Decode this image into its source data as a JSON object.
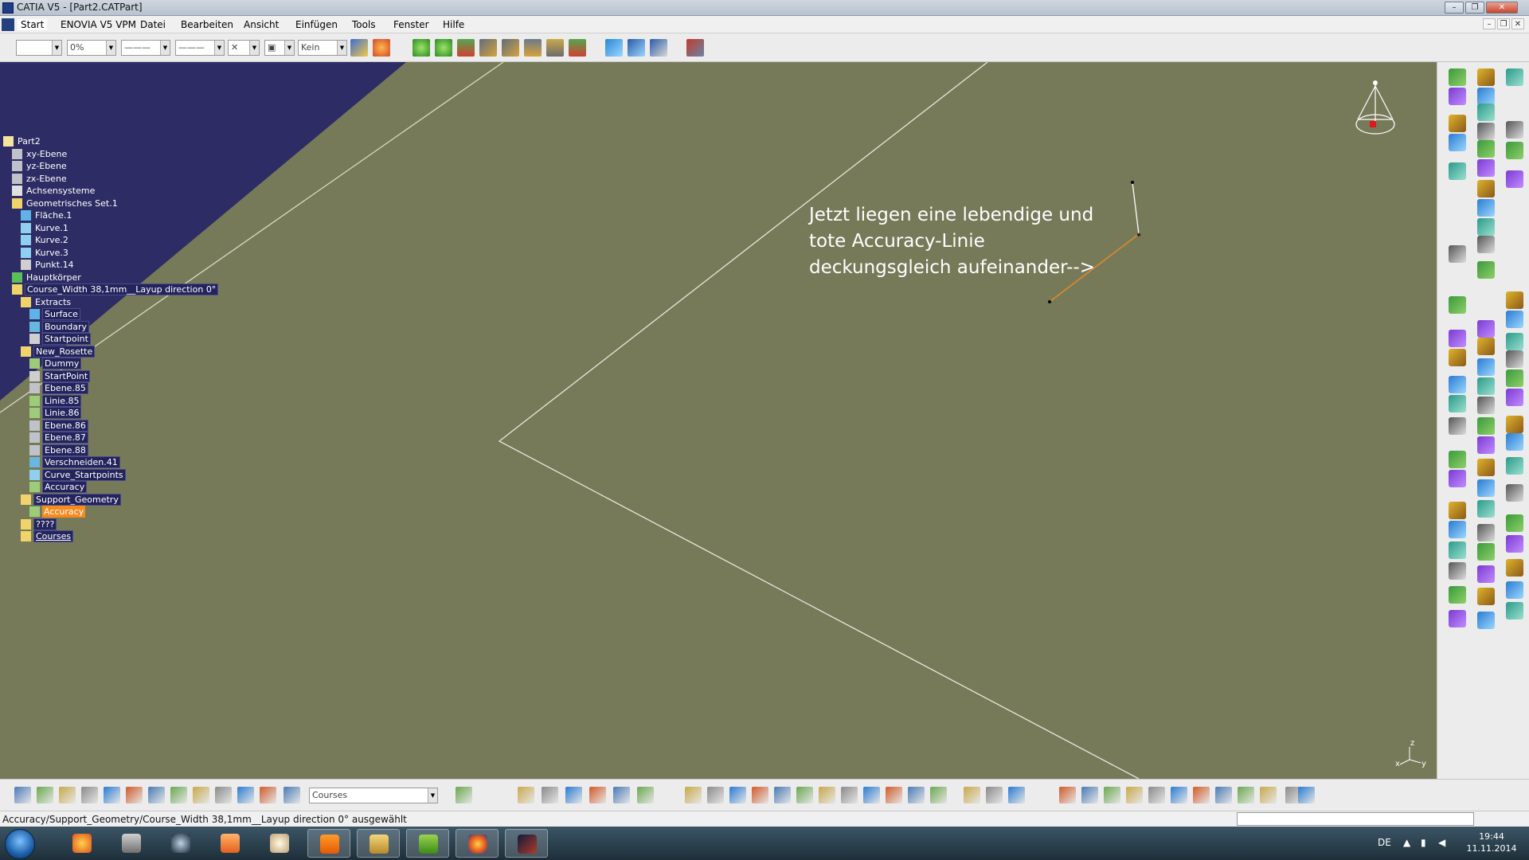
{
  "window": {
    "title": "CATIA V5 - [Part2.CATPart]"
  },
  "menu": {
    "items": [
      "Start",
      "ENOVIA V5 VPM",
      "Datei",
      "Bearbeiten",
      "Ansicht",
      "Einfügen",
      "Tools",
      "Fenster",
      "Hilfe"
    ]
  },
  "toolbar_top": {
    "transparency_value": "0%",
    "layer_value": "Kein"
  },
  "tree": {
    "nodes": [
      {
        "label": "Part2",
        "icon": "part-icon"
      },
      {
        "label": "xy-Ebene",
        "icon": "plane-icon"
      },
      {
        "label": "yz-Ebene",
        "icon": "plane-icon"
      },
      {
        "label": "zx-Ebene",
        "icon": "plane-icon"
      },
      {
        "label": "Achsensysteme",
        "icon": "axis-system-icon"
      },
      {
        "label": "Geometrisches Set.1",
        "icon": "geometrical-set-icon"
      },
      {
        "label": "Fläche.1",
        "icon": "surface-icon"
      },
      {
        "label": "Kurve.1",
        "icon": "curve-icon"
      },
      {
        "label": "Kurve.2",
        "icon": "curve-icon"
      },
      {
        "label": "Kurve.3",
        "icon": "curve-icon"
      },
      {
        "label": "Punkt.14",
        "icon": "point-icon"
      },
      {
        "label": "Hauptkörper",
        "icon": "body-icon"
      },
      {
        "label": "Course_Width 38,1mm__Layup direction 0°",
        "icon": "geometrical-set-icon",
        "state": "selected"
      },
      {
        "label": "Extracts",
        "icon": "geometrical-set-icon"
      },
      {
        "label": "Surface",
        "icon": "surface-icon",
        "state": "selected"
      },
      {
        "label": "Boundary",
        "icon": "boundary-icon",
        "state": "selected"
      },
      {
        "label": "Startpoint",
        "icon": "point-icon",
        "state": "selected"
      },
      {
        "label": "New_Rosette",
        "icon": "geometrical-set-icon",
        "state": "selected"
      },
      {
        "label": "Dummy",
        "icon": "line-icon",
        "state": "selected"
      },
      {
        "label": "StartPoint",
        "icon": "point-icon",
        "state": "selected"
      },
      {
        "label": "Ebene.85",
        "icon": "plane-icon",
        "state": "selected"
      },
      {
        "label": "Linie.85",
        "icon": "line-icon",
        "state": "selected"
      },
      {
        "label": "Linie.86",
        "icon": "line-icon",
        "state": "selected"
      },
      {
        "label": "Ebene.86",
        "icon": "plane-icon",
        "state": "selected"
      },
      {
        "label": "Ebene.87",
        "icon": "plane-icon",
        "state": "selected"
      },
      {
        "label": "Ebene.88",
        "icon": "plane-icon",
        "state": "selected"
      },
      {
        "label": "Verschneiden.41",
        "icon": "intersect-icon",
        "state": "selected"
      },
      {
        "label": "Curve_Startpoints",
        "icon": "curve-icon",
        "state": "selected"
      },
      {
        "label": "Accuracy",
        "icon": "line-icon",
        "state": "selected"
      },
      {
        "label": "Support_Geometry",
        "icon": "geometrical-set-icon",
        "state": "selected"
      },
      {
        "label": "Accuracy",
        "icon": "line-icon",
        "state": "active"
      },
      {
        "label": "????",
        "icon": "geometrical-set-icon",
        "state": "selected"
      },
      {
        "label": "Courses",
        "icon": "geometrical-set-icon",
        "state": "selected"
      }
    ]
  },
  "annotation": {
    "lines": [
      "Jetzt liegen eine lebendige und",
      "tote Accuracy-Linie",
      "deckungsgleich aufeinander-->"
    ]
  },
  "toolbar_bottom": {
    "combo_value": "Courses"
  },
  "status": {
    "text": "Accuracy/Support_Geometry/Course_Width 38,1mm__Layup direction 0° ausgewählt"
  },
  "taskbar": {
    "lang": "DE",
    "time": "19:44",
    "date": "11.11.2014"
  },
  "colors": {
    "viewport_bg": "#777a59",
    "tree_bg": "#2e2c64",
    "selection_bg": "#24245c",
    "active_orange": "#f58b1f"
  }
}
